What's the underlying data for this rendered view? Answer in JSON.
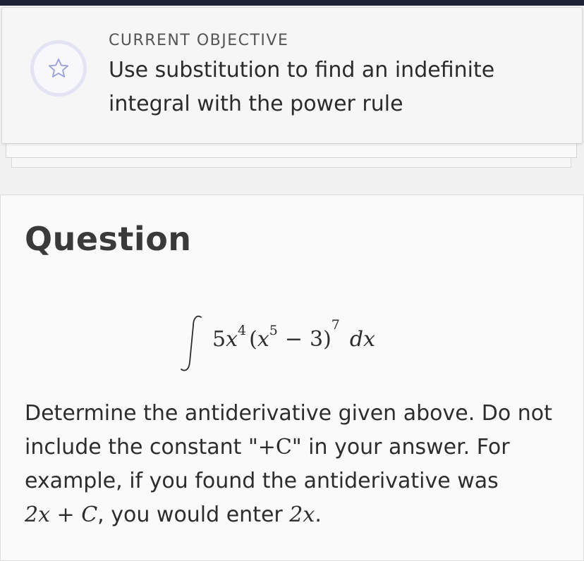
{
  "objective": {
    "label": "CURRENT OBJECTIVE",
    "text": "Use substitution to find an indefinite integral with the power rule",
    "icon": "star-icon"
  },
  "question": {
    "title": "Question",
    "integral": {
      "coefficient": "5",
      "variable": "x",
      "exp1": "4",
      "inner_exp": "5",
      "constant": "3",
      "outer_exp": "7",
      "differential": "dx"
    },
    "body_part1": "Determine the antiderivative given above. Do not include the constant \"",
    "body_plusC": "+C",
    "body_part2": "\" in your answer. For example, if you found the antiderivative was",
    "body_example_lhs": "2x + C",
    "body_part3": ", you would enter",
    "body_example_rhs": "2x",
    "body_end": "."
  },
  "colors": {
    "topbar": "#1d2136",
    "star_ring": "#e3e3f3",
    "star": "#9aa0d8"
  }
}
